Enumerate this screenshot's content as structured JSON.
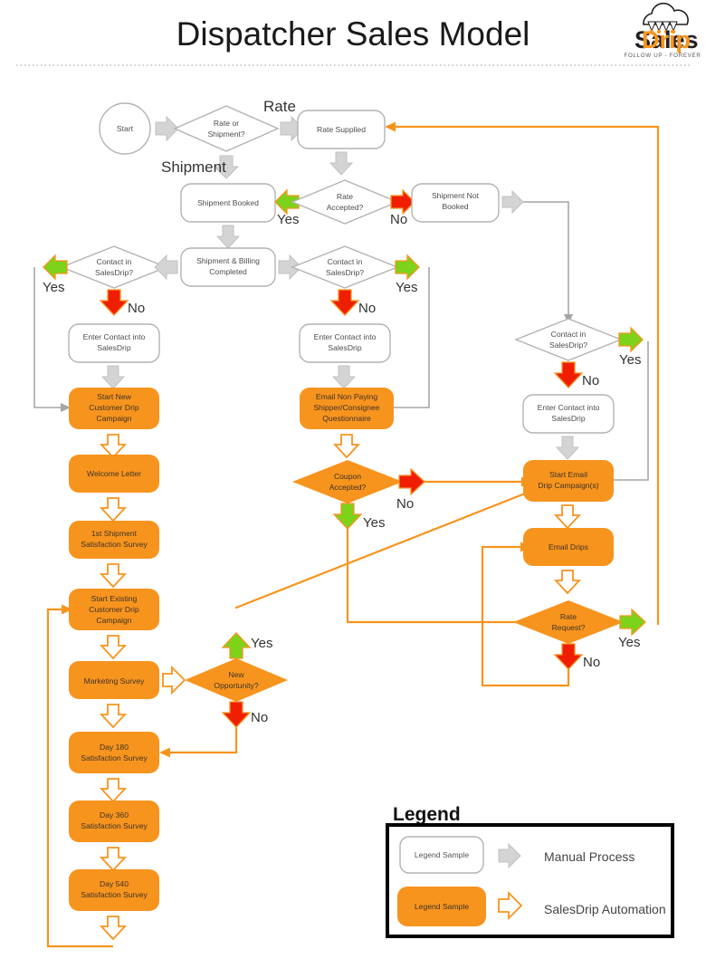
{
  "header": {
    "title": "Dispatcher Sales Model",
    "logo": {
      "brand_a": "Sales",
      "brand_b": "Drip",
      "tagline": "FOLLOW UP - FOREVER"
    }
  },
  "colors": {
    "orange": "#F7941E",
    "green": "#7DD31A",
    "red": "#F01E00",
    "gray": "#A6A6A6",
    "box_stroke": "#B3B3B3"
  },
  "nodes": {
    "start": "Start",
    "rate_or_shipment": "Rate or\nShipment?",
    "rate_or_shipment_l1": "Rate or",
    "rate_or_shipment_l2": "Shipment?",
    "rate_supplied": "Rate Supplied",
    "shipment_booked": "Shipment Booked",
    "rate_accepted_l1": "Rate",
    "rate_accepted_l2": "Accepted?",
    "shipment_not_booked_l1": "Shipment Not",
    "shipment_not_booked_l2": "Booked",
    "shipment_billing_l1": "Shipment & Billing",
    "shipment_billing_l2": "Completed",
    "contact_left_l1": "Contact in",
    "contact_left_l2": "SalesDrip?",
    "contact_mid_l1": "Contact in",
    "contact_mid_l2": "SalesDrip?",
    "contact_right_l1": "Contact in",
    "contact_right_l2": "SalesDrip?",
    "enter_contact_left_l1": "Enter Contact into",
    "enter_contact_left_l2": "SalesDrip",
    "enter_contact_mid_l1": "Enter Contact into",
    "enter_contact_mid_l2": "SalesDrip",
    "enter_contact_right_l1": "Enter Contact into",
    "enter_contact_right_l2": "SalesDrip",
    "start_new_l1": "Start New",
    "start_new_l2": "Customer Drip",
    "start_new_l3": "Campaign",
    "welcome_letter": "Welcome Letter",
    "first_shipment_l1": "1st Shipment",
    "first_shipment_l2": "Satisfaction Survey",
    "start_existing_l1": "Start Existing",
    "start_existing_l2": "Customer Drip",
    "start_existing_l3": "Campaign",
    "marketing_survey": "Marketing Survey",
    "day180_l1": "Day 180",
    "day180_l2": "Satisfaction Survey",
    "day360_l1": "Day 360",
    "day360_l2": "Satisfaction Survey",
    "day540_l1": "Day 540",
    "day540_l2": "Satisfaction Survey",
    "email_non_paying_l1": "Email Non Paying",
    "email_non_paying_l2": "Shipper/Consignee",
    "email_non_paying_l3": "Questionnaire",
    "coupon_l1": "Coupon",
    "coupon_l2": "Accepted?",
    "new_opp_l1": "New",
    "new_opp_l2": "Opportunity?",
    "start_email_drip_l1": "Start Email",
    "start_email_drip_l2": "Drip Campaign(s)",
    "email_drips": "Email Drips",
    "rate_request_l1": "Rate",
    "rate_request_l2": "Request?"
  },
  "edge_labels": {
    "rate": "Rate",
    "shipment": "Shipment",
    "yes_rate_accepted": "Yes",
    "no_rate_accepted": "No",
    "yes_contact_left": "Yes",
    "no_contact_left": "No",
    "yes_contact_mid": "Yes",
    "no_contact_mid": "No",
    "yes_contact_right": "Yes",
    "no_contact_right": "No",
    "no_coupon": "No",
    "yes_coupon": "Yes",
    "yes_new_opp": "Yes",
    "no_new_opp": "No",
    "yes_rate_request": "Yes",
    "no_rate_request": "No"
  },
  "legend": {
    "title": "Legend",
    "sample_label": "Legend Sample",
    "rows": [
      {
        "sample": "Legend Sample",
        "text": "Manual Process",
        "kind": "manual"
      },
      {
        "sample": "Legend Sample",
        "text": "SalesDrip Automation",
        "kind": "automation"
      }
    ]
  }
}
